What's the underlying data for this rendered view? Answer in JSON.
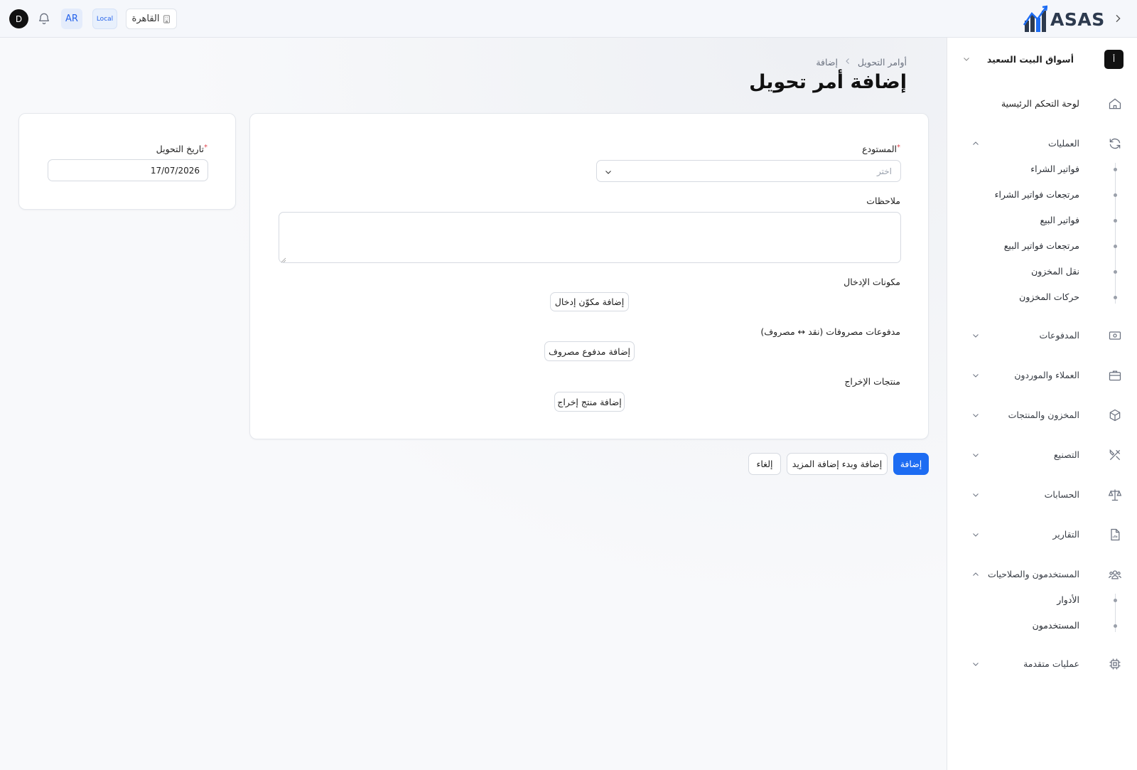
{
  "topbar": {
    "brand": "ASAS",
    "avatar_initial": "D",
    "language": "AR",
    "environment": "Local",
    "branch": "القاهرة"
  },
  "sidebar": {
    "company_initial": "أ",
    "company_name": "أسواق البيت السعيد",
    "dashboard": "لوحة التحكم الرئيسية",
    "operations": {
      "label": "العمليات",
      "items": [
        "فواتير الشراء",
        "مرتجعات فواتير الشراء",
        "فواتير البيع",
        "مرتجعات فواتير البيع",
        "نقل المخزون",
        "حركات المخزون"
      ]
    },
    "payments": "المدفوعات",
    "customers_suppliers": "العملاء والموردون",
    "inventory_products": "المخزون والمنتجات",
    "manufacturing": "التصنيع",
    "accounts": "الحسابات",
    "reports": "التقارير",
    "users_permissions": {
      "label": "المستخدمون والصلاحيات",
      "items": [
        "الأدوار",
        "المستخدمون"
      ]
    },
    "advanced_operations": "عمليات متقدمة"
  },
  "page": {
    "breadcrumb_parent": "أوامر التحويل",
    "breadcrumb_current": "إضافة",
    "title": "إضافة أمر تحويل"
  },
  "form": {
    "warehouse_label": "المستودع",
    "warehouse_placeholder": "اختر",
    "notes_label": "ملاحظات",
    "inputs_label": "مكونات الإدخال",
    "add_input_button": "إضافة مكوّن إدخال",
    "expenses_label": "مدفوعات مصروفات (نقد ↔ مصروف)",
    "add_expense_button": "إضافة مدفوع مصروف",
    "outputs_label": "منتجات الإخراج",
    "add_output_button": "إضافة منتج إخراج",
    "date_label": "تاريخ التحويل",
    "date_value": "17/07/2026"
  },
  "actions": {
    "add": "إضافة",
    "add_and_more": "إضافة وبدء إضافة المزيد",
    "cancel": "إلغاء"
  },
  "colors": {
    "primary": "#1d6cf2",
    "required": "#e0454d"
  }
}
